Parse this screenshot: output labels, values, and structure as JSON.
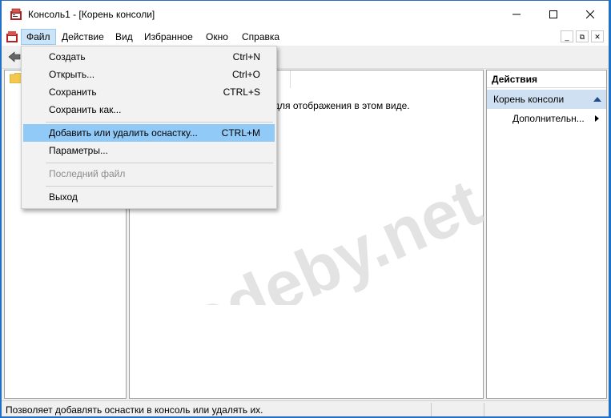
{
  "window": {
    "title": "Консоль1 - [Корень консоли]",
    "minimize_glyph": "—",
    "maximize_glyph": "☐",
    "close_glyph": "✕"
  },
  "menubar": {
    "items": [
      "Файл",
      "Действие",
      "Вид",
      "Избранное",
      "Окно",
      "Справка"
    ],
    "mdi_minimize": "_",
    "mdi_restore": "⧉",
    "mdi_close": "✕"
  },
  "file_menu": {
    "items": [
      {
        "label": "Создать",
        "shortcut": "Ctrl+N"
      },
      {
        "label": "Открыть...",
        "shortcut": "Ctrl+O"
      },
      {
        "label": "Сохранить",
        "shortcut": "CTRL+S"
      },
      {
        "label": "Сохранить как...",
        "shortcut": ""
      },
      {
        "label": "Добавить или удалить оснастку...",
        "shortcut": "CTRL+M",
        "highlighted": true
      },
      {
        "label": "Параметры...",
        "shortcut": ""
      },
      {
        "label": "Последний файл",
        "shortcut": "",
        "disabled": true
      },
      {
        "label": "Выход",
        "shortcut": ""
      }
    ]
  },
  "center_pane": {
    "empty_message": "для отображения в этом виде."
  },
  "actions_pane": {
    "header": "Действия",
    "group": "Корень консоли",
    "sub_item": "Дополнительн..."
  },
  "statusbar": {
    "text": "Позволяет добавлять оснастки в консоль или удалять их."
  },
  "watermark": {
    "text": "codeby.net"
  },
  "icons": {
    "app": "mmc-console-icon",
    "back": "back-arrow-icon",
    "folder": "folder-icon"
  },
  "colors": {
    "desktop": "#1a73c8",
    "menu_highlight": "#91c9f7",
    "actions_group": "#cfe0f2",
    "watermark": "#d9d9d9"
  }
}
